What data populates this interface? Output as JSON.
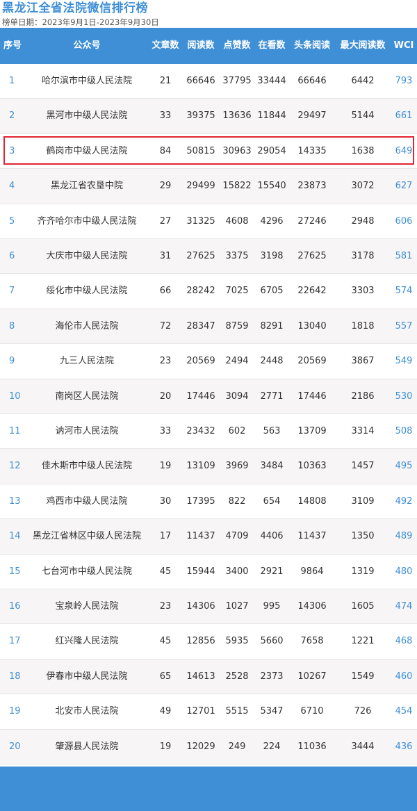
{
  "page": {
    "title": "黑龙江全省法院微信排行榜",
    "subtitle": "榜单日期：2023年9月1日-2023年9月30日"
  },
  "table": {
    "headers": {
      "rank": "序号",
      "account": "公众号",
      "articles": "文章数",
      "reads": "阅读数",
      "likes": "点赞数",
      "watching": "在看数",
      "headline_reads": "头条阅读",
      "max_reads": "最大阅读数",
      "wci": "WCI"
    },
    "highlighted_rank": "3",
    "rows": [
      {
        "rank": "1",
        "account": "哈尔滨市中级人民法院",
        "articles": "21",
        "reads": "66646",
        "likes": "37795",
        "watching": "33444",
        "headline_reads": "66646",
        "max_reads": "6442",
        "wci": "793"
      },
      {
        "rank": "2",
        "account": "黑河市中级人民法院",
        "articles": "33",
        "reads": "39375",
        "likes": "13636",
        "watching": "11844",
        "headline_reads": "29497",
        "max_reads": "5144",
        "wci": "661"
      },
      {
        "rank": "3",
        "account": "鹤岗市中级人民法院",
        "articles": "84",
        "reads": "50815",
        "likes": "30963",
        "watching": "29054",
        "headline_reads": "14335",
        "max_reads": "1638",
        "wci": "649"
      },
      {
        "rank": "4",
        "account": "黑龙江省农垦中院",
        "articles": "29",
        "reads": "29499",
        "likes": "15822",
        "watching": "15540",
        "headline_reads": "23873",
        "max_reads": "3072",
        "wci": "627"
      },
      {
        "rank": "5",
        "account": "齐齐哈尔市中级人民法院",
        "articles": "27",
        "reads": "31325",
        "likes": "4608",
        "watching": "4296",
        "headline_reads": "27246",
        "max_reads": "2948",
        "wci": "606"
      },
      {
        "rank": "6",
        "account": "大庆市中级人民法院",
        "articles": "31",
        "reads": "27625",
        "likes": "3375",
        "watching": "3198",
        "headline_reads": "27625",
        "max_reads": "3178",
        "wci": "581"
      },
      {
        "rank": "7",
        "account": "绥化市中级人民法院",
        "articles": "66",
        "reads": "28242",
        "likes": "7025",
        "watching": "6705",
        "headline_reads": "22642",
        "max_reads": "3303",
        "wci": "574"
      },
      {
        "rank": "8",
        "account": "海伦市人民法院",
        "articles": "72",
        "reads": "28347",
        "likes": "8759",
        "watching": "8291",
        "headline_reads": "13040",
        "max_reads": "1818",
        "wci": "557"
      },
      {
        "rank": "9",
        "account": "九三人民法院",
        "articles": "23",
        "reads": "20569",
        "likes": "2494",
        "watching": "2448",
        "headline_reads": "20569",
        "max_reads": "3867",
        "wci": "549"
      },
      {
        "rank": "10",
        "account": "南岗区人民法院",
        "articles": "20",
        "reads": "17446",
        "likes": "3094",
        "watching": "2771",
        "headline_reads": "17446",
        "max_reads": "2186",
        "wci": "530"
      },
      {
        "rank": "11",
        "account": "讷河市人民法院",
        "articles": "33",
        "reads": "23432",
        "likes": "602",
        "watching": "563",
        "headline_reads": "13709",
        "max_reads": "3314",
        "wci": "508"
      },
      {
        "rank": "12",
        "account": "佳木斯市中级人民法院",
        "articles": "19",
        "reads": "13109",
        "likes": "3969",
        "watching": "3484",
        "headline_reads": "10363",
        "max_reads": "1457",
        "wci": "495"
      },
      {
        "rank": "13",
        "account": "鸡西市中级人民法院",
        "articles": "30",
        "reads": "17395",
        "likes": "822",
        "watching": "654",
        "headline_reads": "14808",
        "max_reads": "3109",
        "wci": "492"
      },
      {
        "rank": "14",
        "account": "黑龙江省林区中级人民法院",
        "articles": "17",
        "reads": "11437",
        "likes": "4709",
        "watching": "4406",
        "headline_reads": "11437",
        "max_reads": "1350",
        "wci": "489"
      },
      {
        "rank": "15",
        "account": "七台河市中级人民法院",
        "articles": "45",
        "reads": "15944",
        "likes": "3400",
        "watching": "2921",
        "headline_reads": "9864",
        "max_reads": "1319",
        "wci": "480"
      },
      {
        "rank": "16",
        "account": "宝泉岭人民法院",
        "articles": "23",
        "reads": "14306",
        "likes": "1027",
        "watching": "995",
        "headline_reads": "14306",
        "max_reads": "1605",
        "wci": "474"
      },
      {
        "rank": "17",
        "account": "红兴隆人民法院",
        "articles": "45",
        "reads": "12856",
        "likes": "5935",
        "watching": "5660",
        "headline_reads": "7658",
        "max_reads": "1221",
        "wci": "468"
      },
      {
        "rank": "18",
        "account": "伊春市中级人民法院",
        "articles": "65",
        "reads": "14613",
        "likes": "2528",
        "watching": "2373",
        "headline_reads": "10267",
        "max_reads": "1549",
        "wci": "460"
      },
      {
        "rank": "19",
        "account": "北安市人民法院",
        "articles": "49",
        "reads": "12701",
        "likes": "5515",
        "watching": "5347",
        "headline_reads": "6710",
        "max_reads": "726",
        "wci": "454"
      },
      {
        "rank": "20",
        "account": "肇源县人民法院",
        "articles": "19",
        "reads": "12029",
        "likes": "249",
        "watching": "224",
        "headline_reads": "11036",
        "max_reads": "3444",
        "wci": "436"
      }
    ]
  },
  "colors": {
    "accent": "#3f8fd6",
    "highlight_border": "#e02430",
    "row_alt": "#f7f5f5"
  }
}
